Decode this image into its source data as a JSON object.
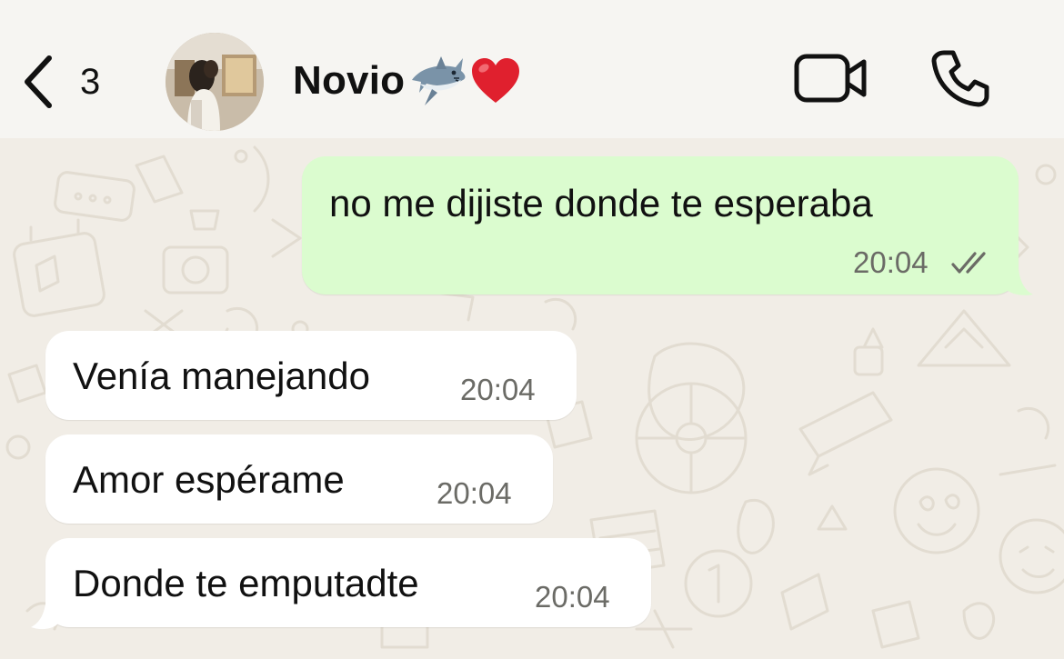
{
  "header": {
    "back_count": "3",
    "contact_name": "Novio",
    "contact_emojis": [
      "shark",
      "red-heart"
    ]
  },
  "messages": [
    {
      "direction": "outgoing",
      "text": "no me dijiste donde te esperaba",
      "time": "20:04",
      "status": "read"
    },
    {
      "direction": "incoming",
      "text": "Venía manejando",
      "time": "20:04"
    },
    {
      "direction": "incoming",
      "text": "Amor espérame",
      "time": "20:04"
    },
    {
      "direction": "incoming",
      "text": "Donde te emputadte",
      "time": "20:04"
    }
  ],
  "colors": {
    "header_bg": "#f6f5f2",
    "chat_bg": "#f1ede6",
    "outgoing_bubble": "#dbfccf",
    "incoming_bubble": "#ffffff",
    "read_tick": "#6b6b66"
  }
}
